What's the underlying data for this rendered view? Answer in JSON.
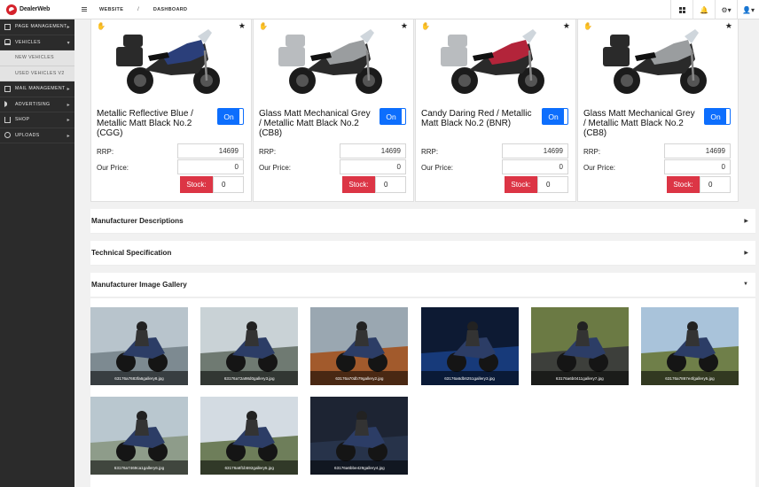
{
  "app": {
    "logo_text": "DealerWeb"
  },
  "sidebar": {
    "items": [
      {
        "label": "PAGE MANAGEMENT"
      },
      {
        "label": "VEHICLES"
      },
      {
        "label": "NEW VEHICLES"
      },
      {
        "label": "USED VEHICLES V2"
      },
      {
        "label": "MAIL MANAGEMENT"
      },
      {
        "label": "ADVERTISING"
      },
      {
        "label": "SHOP"
      },
      {
        "label": "UPLOADS"
      }
    ]
  },
  "breadcrumb": {
    "item1": "WEBSITE",
    "separator": "/",
    "item2": "DASHBOARD"
  },
  "cards": [
    {
      "title": "Metallic Reflective Blue / Metallic Matt Black No.2 (CGG)",
      "toggle": "On",
      "rrp_label": "RRP:",
      "rrp": "14699",
      "price_label": "Our Price:",
      "price": "0",
      "stock_label": "Stock:",
      "stock": "0",
      "color": "#2b3f7a",
      "luggage": "#2a2a2a"
    },
    {
      "title": "Glass Matt Mechanical Grey / Metallic Matt Black No.2 (CB8)",
      "toggle": "On",
      "rrp_label": "RRP:",
      "rrp": "14699",
      "price_label": "Our Price:",
      "price": "0",
      "stock_label": "Stock:",
      "stock": "0",
      "color": "#9a9d9f",
      "luggage": "#b9bcbf"
    },
    {
      "title": "Candy Daring Red / Metallic Matt Black No.2 (BNR)",
      "toggle": "On",
      "rrp_label": "RRP:",
      "rrp": "14699",
      "price_label": "Our Price:",
      "price": "0",
      "stock_label": "Stock:",
      "stock": "0",
      "color": "#b3243a",
      "luggage": "#b9bcbf"
    },
    {
      "title": "Glass Matt Mechanical Grey / Metallic Matt Black No.2 (CB8)",
      "toggle": "On",
      "rrp_label": "RRP:",
      "rrp": "14699",
      "price_label": "Our Price:",
      "price": "0",
      "stock_label": "Stock:",
      "stock": "0",
      "color": "#9a9d9f",
      "luggage": "#2a2a2a"
    }
  ],
  "sections": {
    "descriptions": "Manufacturer Descriptions",
    "tech_spec": "Technical Specification",
    "gallery": "Manufacturer Image Gallery"
  },
  "gallery": [
    {
      "caption": "63176a7683fa6gallery8.jpg",
      "sky": "#b8c4cc",
      "ground": "#7d8a91"
    },
    {
      "caption": "63176a72a98d0gallery3.jpg",
      "sky": "#c9d2d6",
      "ground": "#6f7a72"
    },
    {
      "caption": "63176a70db79gallery2.jpg",
      "sky": "#9aa7b1",
      "ground": "#a25a2c"
    },
    {
      "caption": "63176a6db6251gallery3.jpg",
      "sky": "#0d1a33",
      "ground": "#173a7a"
    },
    {
      "caption": "63176a6b0411gallery7.jpg",
      "sky": "#6b7a44",
      "ground": "#3d3f3b"
    },
    {
      "caption": "63176a7867e4fgallery5.jpg",
      "sky": "#a9c3da",
      "ground": "#6f7f49"
    },
    {
      "caption": "63176a7469ca1gallery6.jpg",
      "sky": "#b9c7cf",
      "ground": "#8e9c8a"
    },
    {
      "caption": "63176a6f1b592gallery5.jpg",
      "sky": "#d3dbe2",
      "ground": "#6e7e5a"
    },
    {
      "caption": "63176a6bbe429gallery4.jpg",
      "sky": "#1d2433",
      "ground": "#27334a"
    }
  ]
}
